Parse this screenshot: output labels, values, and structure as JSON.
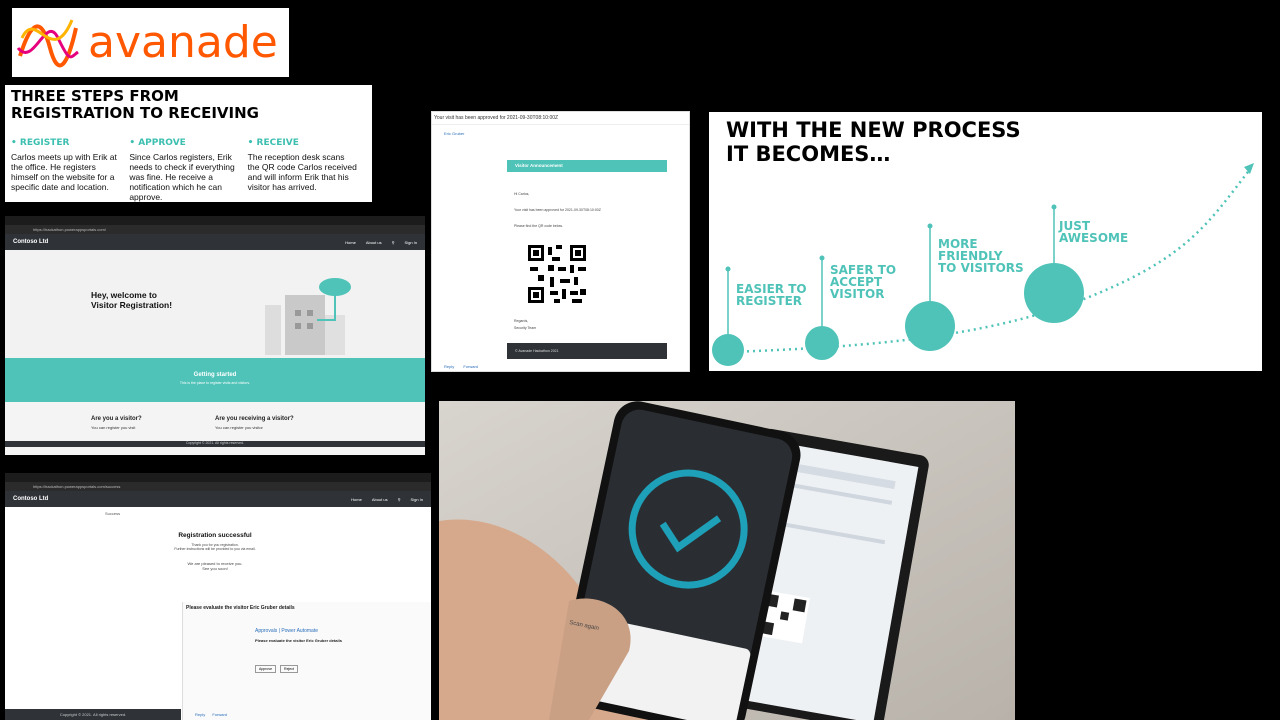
{
  "logo": {
    "text": "avanade"
  },
  "steps": {
    "title_line1": "THREE STEPS FROM",
    "title_line2": "REGISTRATION TO RECEIVING",
    "items": [
      {
        "heading": "REGISTER",
        "text": "Carlos meets up with Erik at the office. He registers himself on the website for a specific date and location."
      },
      {
        "heading": "APPROVE",
        "text": "Since Carlos registers, Erik needs to check if everything was fine. He receive a notification which he can approve."
      },
      {
        "heading": "RECEIVE",
        "text": "The reception desk scans the QR code Carlos received and will inform Erik that his visitor has arrived."
      }
    ]
  },
  "portal": {
    "brand": "Contoso Ltd",
    "nav": [
      "Home",
      "About us",
      "Sign In"
    ],
    "hero_line1": "Hey, welcome to",
    "hero_line2": "Visitor Registration!",
    "getting_started": "Getting started",
    "getting_started_sub": "This is the place to register visits and visitors.",
    "col1_title": "Are you a visitor?",
    "col1_text": "You can register you visit",
    "col2_title": "Are you receiving a visitor?",
    "col2_text": "You can register you visitor",
    "footer": "Copyright © 2021. All rights reserved."
  },
  "success": {
    "brand": "Contoso Ltd",
    "nav": [
      "Home",
      "About us",
      "Sign In"
    ],
    "breadcrumb": "Success",
    "title": "Registration successful",
    "sub1": "Thank you for you registration.",
    "sub2": "Further instructions will be provided to you via email.",
    "sub3": "We are pleased to receive you.",
    "sub4": "See you soon!",
    "footer": "Copyright © 2021. All rights reserved.",
    "approval_subject": "Please evaluate the visitor Eric Gruber details",
    "approvals": "Approvals",
    "power_automate": "Power Automate",
    "approval_heading": "Please evaluate the visitor Eric Gruber details",
    "approve_btn": "Approve",
    "reject_btn": "Reject",
    "reply": "Reply",
    "forward": "Forward"
  },
  "email": {
    "subject": "Your visit has been approved for 2021-09-30T08:10:00Z",
    "sender": "Eric Gruber",
    "banner": "Visitor Announcement",
    "greeting": "Hi Carlos,",
    "line1": "Your visit has been approved for 2021-09-30T08:10:00Z",
    "line2": "Please find the QR code below.",
    "regards": "Regards,",
    "team": "Security Team",
    "footer": "© Avanade Hackathon 2021",
    "reply": "Reply",
    "forward": "Forward"
  },
  "process": {
    "title_line1": "WITH THE NEW PROCESS",
    "title_line2": "IT BECOMES…",
    "stages": [
      {
        "l1": "EASIER TO",
        "l2": "REGISTER",
        "l3": ""
      },
      {
        "l1": "SAFER TO",
        "l2": "ACCEPT",
        "l3": "VISITOR"
      },
      {
        "l1": "MORE",
        "l2": "FRIENDLY",
        "l3": "TO VISITORS"
      },
      {
        "l1": "JUST",
        "l2": "AWESOME",
        "l3": ""
      }
    ],
    "accent": "#4fc3b8"
  },
  "photo": {
    "scan_label": "Scan again"
  }
}
